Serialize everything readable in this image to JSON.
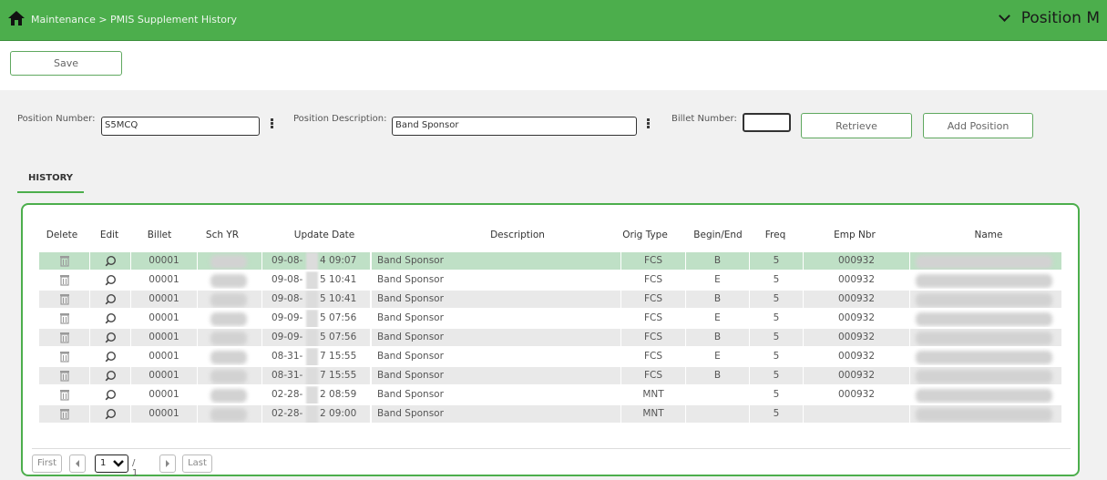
{
  "header": {
    "breadcrumb": "Maintenance > PMIS Supplement History",
    "title": "Position M"
  },
  "toolbar": {
    "save_label": "Save"
  },
  "filters": {
    "position_number_label": "Position Number:",
    "position_number_value": "S5MCQ",
    "position_description_label": "Position Description:",
    "position_description_value": "Band Sponsor",
    "billet_number_label": "Billet Number:",
    "billet_number_value": "",
    "retrieve_label": "Retrieve",
    "add_position_label": "Add Position"
  },
  "tabs": {
    "history": "HISTORY"
  },
  "table": {
    "headers": [
      "Delete",
      "Edit",
      "Billet",
      "Sch YR",
      "Update Date",
      "Description",
      "Orig Type",
      "Begin/End",
      "Freq",
      "Emp Nbr",
      "Name"
    ],
    "rows": [
      {
        "billet": "00001",
        "date_a": "09-08-",
        "date_b": "4 09:07",
        "description": "Band Sponsor",
        "orig_type": "FCS",
        "begin_end": "B",
        "freq": "5",
        "emp_nbr": "000932"
      },
      {
        "billet": "00001",
        "date_a": "09-08-",
        "date_b": "5 10:41",
        "description": "Band Sponsor",
        "orig_type": "FCS",
        "begin_end": "E",
        "freq": "5",
        "emp_nbr": "000932"
      },
      {
        "billet": "00001",
        "date_a": "09-08-",
        "date_b": "5 10:41",
        "description": "Band Sponsor",
        "orig_type": "FCS",
        "begin_end": "B",
        "freq": "5",
        "emp_nbr": "000932"
      },
      {
        "billet": "00001",
        "date_a": "09-09-",
        "date_b": "5 07:56",
        "description": "Band Sponsor",
        "orig_type": "FCS",
        "begin_end": "E",
        "freq": "5",
        "emp_nbr": "000932"
      },
      {
        "billet": "00001",
        "date_a": "09-09-",
        "date_b": "5 07:56",
        "description": "Band Sponsor",
        "orig_type": "FCS",
        "begin_end": "B",
        "freq": "5",
        "emp_nbr": "000932"
      },
      {
        "billet": "00001",
        "date_a": "08-31-",
        "date_b": "7 15:55",
        "description": "Band Sponsor",
        "orig_type": "FCS",
        "begin_end": "E",
        "freq": "5",
        "emp_nbr": "000932"
      },
      {
        "billet": "00001",
        "date_a": "08-31-",
        "date_b": "7 15:55",
        "description": "Band Sponsor",
        "orig_type": "FCS",
        "begin_end": "B",
        "freq": "5",
        "emp_nbr": "000932"
      },
      {
        "billet": "00001",
        "date_a": "02-28-",
        "date_b": "2 08:59",
        "description": "Band Sponsor",
        "orig_type": "MNT",
        "begin_end": "",
        "freq": "5",
        "emp_nbr": "000932"
      },
      {
        "billet": "00001",
        "date_a": "02-28-",
        "date_b": "2 09:00",
        "description": "Band Sponsor",
        "orig_type": "MNT",
        "begin_end": "",
        "freq": "5",
        "emp_nbr": ""
      }
    ]
  },
  "pager": {
    "first": "First",
    "page": "1",
    "of": "/ 1",
    "last": "Last"
  },
  "colors": {
    "brand_green": "#4cae4c",
    "row_selected": "#bfe0c6",
    "row_alt": "#e9e9e9"
  },
  "icons": [
    "home-icon",
    "chevron-down-icon",
    "more-vertical-icon",
    "trash-icon",
    "search-icon",
    "chevron-left-icon",
    "chevron-right-icon"
  ]
}
